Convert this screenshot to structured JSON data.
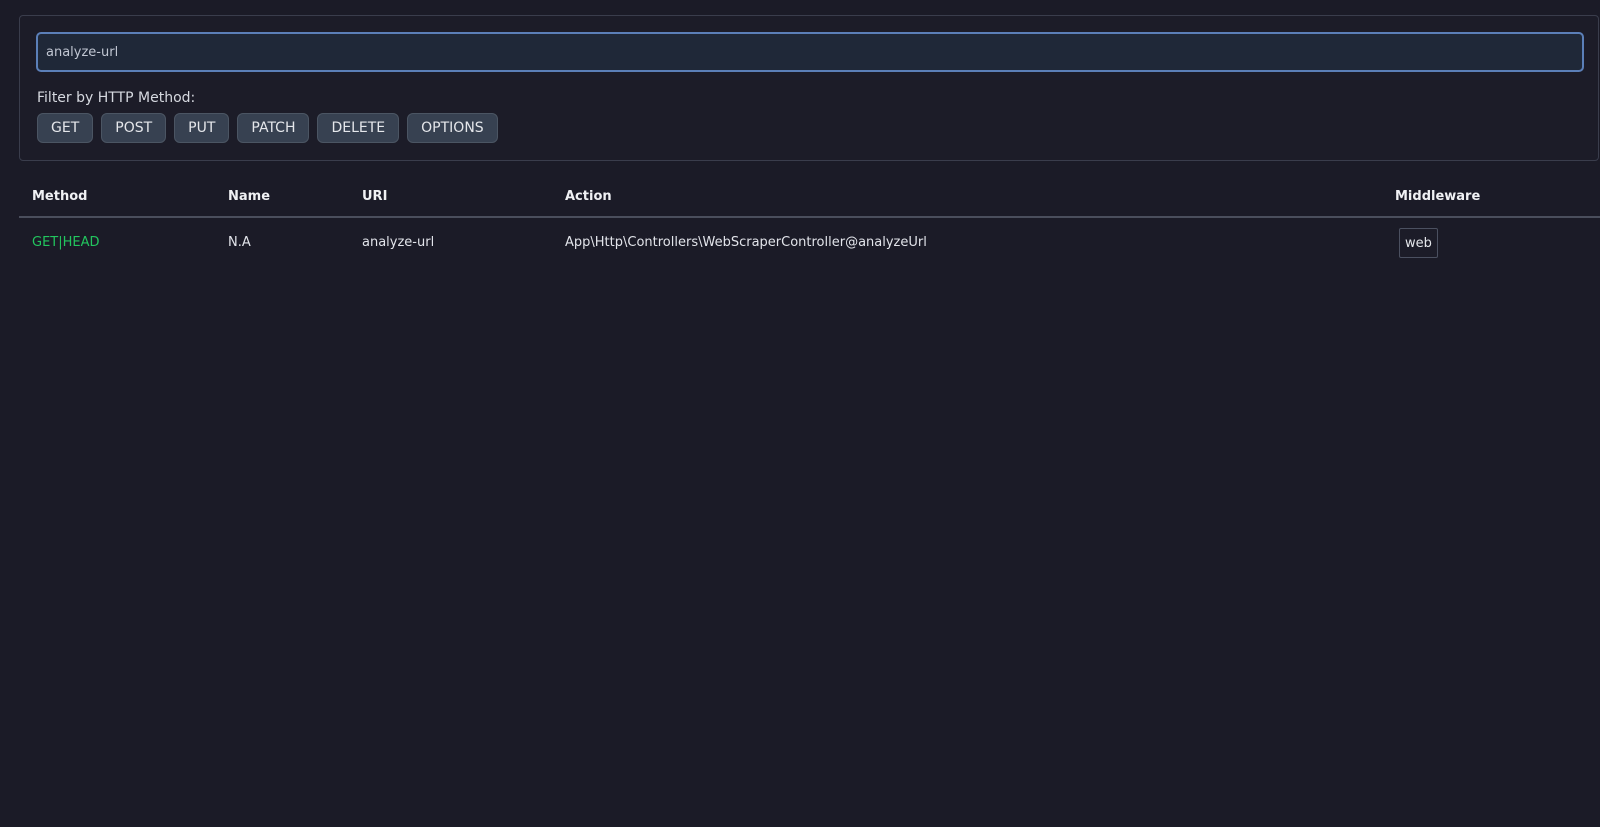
{
  "filters": {
    "search_value": "analyze-url",
    "method_label": "Filter by HTTP Method:",
    "methods": [
      "GET",
      "POST",
      "PUT",
      "PATCH",
      "DELETE",
      "OPTIONS"
    ]
  },
  "table": {
    "headers": {
      "method": "Method",
      "name": "Name",
      "uri": "URI",
      "action": "Action",
      "middleware": "Middleware"
    },
    "rows": [
      {
        "method": "GET|HEAD",
        "name": "N.A",
        "uri": "analyze-url",
        "action": "App\\Http\\Controllers\\WebScraperController@analyzeUrl",
        "middleware": "web"
      }
    ]
  },
  "colors": {
    "background": "#1b1b27",
    "method_green": "#22c55e",
    "input_border": "#5b7fb8"
  }
}
